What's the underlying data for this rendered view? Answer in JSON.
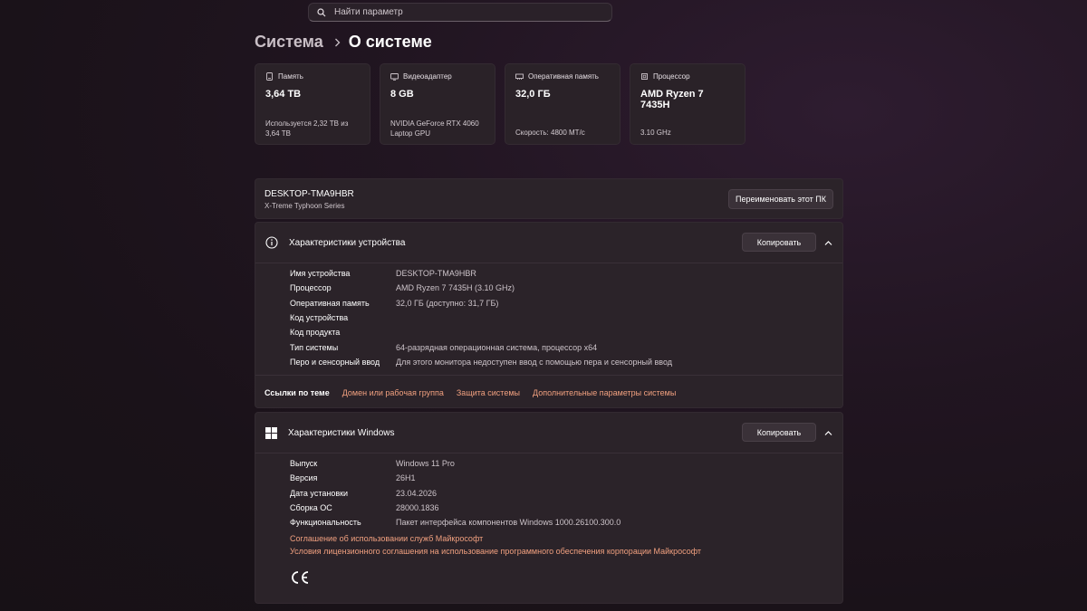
{
  "search": {
    "placeholder": "Найти параметр"
  },
  "breadcrumb": {
    "parent": "Система",
    "current": "О системе"
  },
  "tiles": [
    {
      "title": "Память",
      "value": "3,64 ТВ",
      "sub": "Используется 2,32 ТВ из 3,64 ТВ",
      "icon": "storage-icon"
    },
    {
      "title": "Видеоадаптер",
      "value": "8 GB",
      "sub": "NVIDIA GeForce RTX 4060 Laptop GPU",
      "icon": "gpu-icon"
    },
    {
      "title": "Оперативная память",
      "value": "32,0 ГБ",
      "sub": "Скорость: 4800 MT/c",
      "icon": "ram-icon"
    },
    {
      "title": "Процессор",
      "value": "AMD Ryzen 7 7435H",
      "sub": "3.10 GHz",
      "icon": "cpu-icon"
    }
  ],
  "device": {
    "name": "DESKTOP-TMA9HBR",
    "model": "X-Treme Typhoon Series",
    "rename_label": "Переименовать этот ПК"
  },
  "device_specs": {
    "title": "Характеристики устройства",
    "copy_label": "Копировать",
    "rows": [
      {
        "key": "Имя устройства",
        "value": "DESKTOP-TMA9HBR"
      },
      {
        "key": "Процессор",
        "value": "AMD Ryzen 7 7435H (3.10 GHz)"
      },
      {
        "key": "Оперативная память",
        "value": "32,0 ГБ (доступно: 31,7 ГБ)"
      },
      {
        "key": "Код устройства",
        "value": ""
      },
      {
        "key": "Код продукта",
        "value": ""
      },
      {
        "key": "Тип системы",
        "value": "64-разрядная операционная система, процессор x64"
      },
      {
        "key": "Перо и сенсорный ввод",
        "value": "Для этого монитора недоступен ввод с помощью пера и сенсорный ввод"
      }
    ],
    "related_title": "Ссылки по теме",
    "related_links": [
      "Домен или рабочая группа",
      "Защита системы",
      "Дополнительные параметры системы"
    ]
  },
  "windows_specs": {
    "title": "Характеристики Windows",
    "copy_label": "Копировать",
    "rows": [
      {
        "key": "Выпуск",
        "value": "Windows 11 Pro"
      },
      {
        "key": "Версия",
        "value": "26H1"
      },
      {
        "key": "Дата установки",
        "value": "23.04.2026"
      },
      {
        "key": "Сборка ОС",
        "value": "28000.1836"
      },
      {
        "key": "Функциональность",
        "value": "Пакет интерфейса компонентов Windows 1000.26100.300.0"
      }
    ],
    "legal_links": [
      "Соглашение об использовании служб Майкрософт",
      "Условия лицензионного соглашения на использование программного обеспечения корпорации Майкрософт"
    ]
  },
  "colors": {
    "accent_link": "#f1a07f",
    "card_bg": "#2b2329",
    "window_bg": "#1a1219"
  }
}
